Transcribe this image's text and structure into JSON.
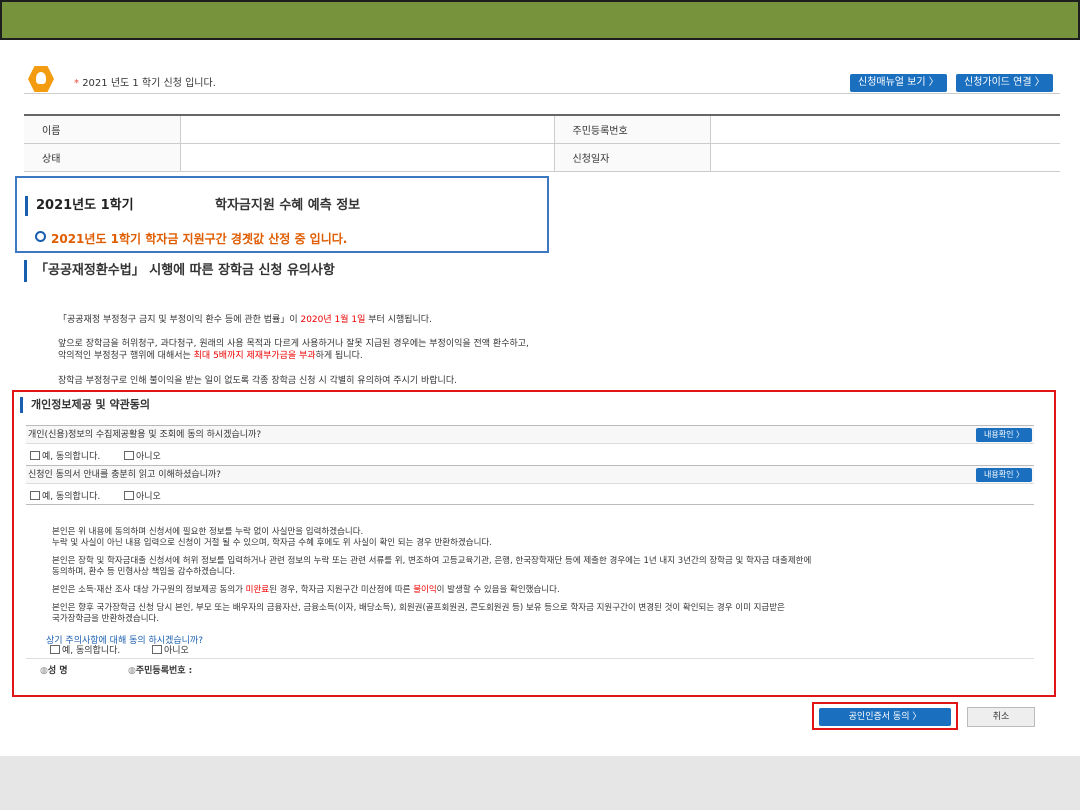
{
  "header": {
    "notice": "2021 년도 1 학기 신청 입니다.",
    "manual_button": "신청매뉴얼 보기 〉",
    "guide_button": "신청가이드 연결 〉"
  },
  "info": {
    "name_label": "이름",
    "name_value": "",
    "rrn_label": "주민등록번호",
    "rrn_value": "",
    "status_label": "상태",
    "status_value": "",
    "date_label": "신청일자",
    "date_value": ""
  },
  "prediction": {
    "title_left": "2021년도 1학기",
    "title_right": "학자금지원 수혜 예측 정보",
    "message": "2021년도 1학기 학자금 지원구간 경곗값 산정 중 입니다."
  },
  "notice_section": {
    "title": "「공공재정환수법」 시행에 따른 장학금 신청 유의사항",
    "p1a": "「공공재정 부정청구 금지 및 부정이익 환수 등에 관한 법률」이 ",
    "p1_date": "2020년 1월 1일",
    "p1b": " 부터 시행됩니다.",
    "p2": "앞으로 장학금을 허위청구, 과다청구, 원래의 사용 목적과 다르게 사용하거나 잘못 지급된 경우에는 부정이익을 전액 환수하고,",
    "p3a": "악의적인 부정청구 행위에 대해서는 ",
    "p3_red": "최대 5배까지 제재부가금을 부과",
    "p3b": "하게 됩니다.",
    "p4": "장학금 부정청구로 인해 불이익을 받는 일이 없도록 각종 장학금 신청 시 각별히 유의하여 주시기 바랍니다."
  },
  "consent": {
    "title": "개인정보제공 및 약관동의",
    "q1": "개인(신용)정보의 수집제공활용 및 조회에 동의 하시겠습니까?",
    "q1_button": "내용확인 〉",
    "q1_yes": "예, 동의합니다.",
    "q1_no": "아니오",
    "q2": "신청인 동의서 안내를 충분히 읽고 이해하셨습니까?",
    "q2_button": "내용확인 〉",
    "q2_yes": "예, 동의합니다.",
    "q2_no": "아니오",
    "t1": "본인은 위 내용에 동의하며 신청서에 필요한 정보를 누락 없이 사실만을 입력하겠습니다.",
    "t2": "누락 및 사실이 아닌 내용 입력으로 신청이 거절 될 수 있으며, 학자금 수혜 후에도 위 사실이 확인 되는 경우 반환하겠습니다.",
    "t3": "본인은 장학 및 학자금대출 신청서에 허위 정보를 입력하거나 관련 정보의 누락 또는 관련 서류를 위, 변조하여 고등교육기관, 은행, 한국장학재단 등에 제출한 경우에는 1년 내지 3년간의 장학금 및 학자금 대출제한에",
    "t4": "동의하며, 환수 등 민형사상 책임을 감수하겠습니다.",
    "t5a": "본인은 소득·재산 조사 대상 가구원의 정보제공 동의가 ",
    "t5_red1": "미완료",
    "t5b": "된 경우, 학자금 지원구간 미산정에 따른 ",
    "t5_red2": "불이익",
    "t5c": "이 발생할 수 있음을 확인했습니다.",
    "t6": "본인은 향후 국가장학금 신청 당시 본인, 부모 또는 배우자의 금융자산, 금융소득(이자, 배당소득), 회원권(골프회원권, 콘도회원권 등) 보유 등으로 학자금 지원구간이 변경된 것이 확인되는 경우 이미 지급받은",
    "t7": "국가장학금을 반환하겠습니다.",
    "final_q": "상기 주의사항에 대해 동의 하시겠습니까?",
    "final_yes": "예, 동의합니다.",
    "final_no": "아니오",
    "sig_name": "성 명",
    "sig_rrn": "주민등록번호 :"
  },
  "actions": {
    "cert_button": "공인인증서 동의 〉",
    "cancel_button": "취소"
  }
}
